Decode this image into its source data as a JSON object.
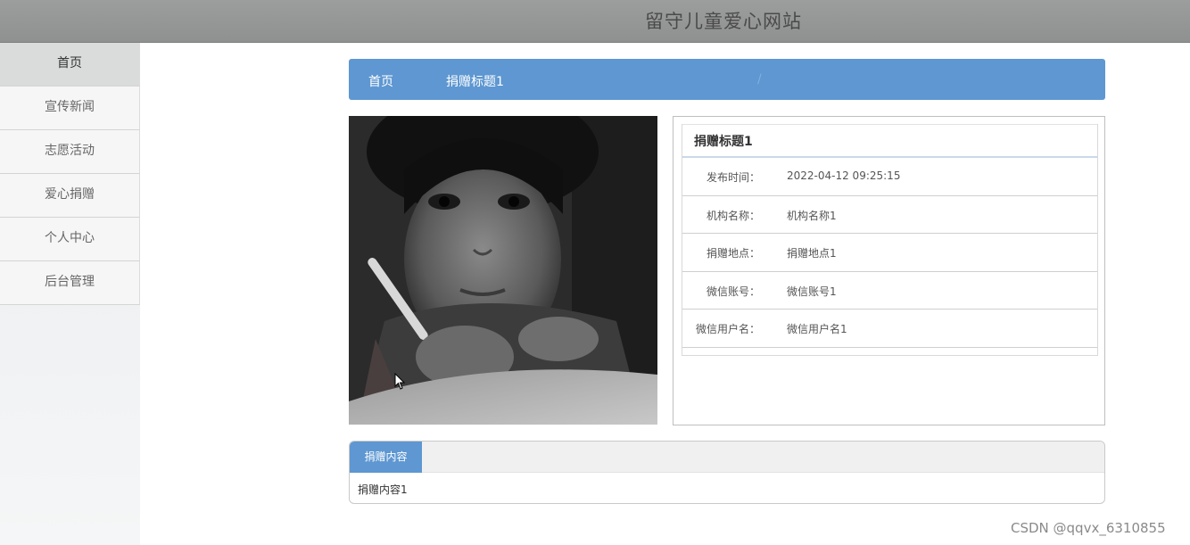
{
  "header": {
    "title": "留守儿童爱心网站"
  },
  "sidebar": {
    "items": [
      {
        "label": "首页"
      },
      {
        "label": "宣传新闻"
      },
      {
        "label": "志愿活动"
      },
      {
        "label": "爱心捐赠"
      },
      {
        "label": "个人中心"
      },
      {
        "label": "后台管理"
      }
    ]
  },
  "breadcrumb": {
    "home": "首页",
    "current": "捐赠标题1"
  },
  "detail": {
    "title": "捐赠标题1",
    "rows": [
      {
        "label": "发布时间：",
        "value": "2022-04-12 09:25:15"
      },
      {
        "label": "机构名称：",
        "value": "机构名称1"
      },
      {
        "label": "捐赠地点：",
        "value": "捐赠地点1"
      },
      {
        "label": "微信账号：",
        "value": "微信账号1"
      },
      {
        "label": "微信用户名：",
        "value": "微信用户名1"
      }
    ]
  },
  "content": {
    "tab_label": "捐赠内容",
    "text": "捐赠内容1"
  },
  "watermark": "CSDN @qqvx_6310855",
  "colors": {
    "accent": "#5e97d1",
    "header_bg": "#999b9a"
  }
}
